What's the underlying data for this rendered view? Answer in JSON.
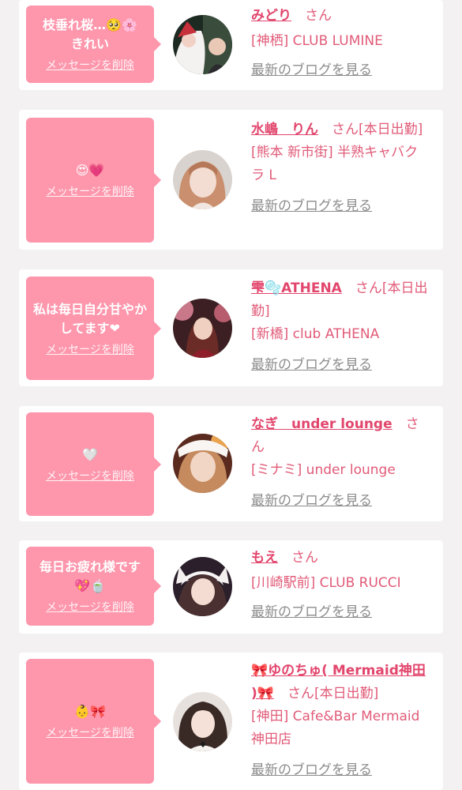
{
  "delete_label": "メッセージを削除",
  "blog_label": "最新のブログを見る",
  "san": "さん",
  "colors": {
    "bubble": "#fe96ac",
    "name": "#e2466d",
    "text": "#e15b78",
    "link": "#8c8c8c",
    "background": "#f3f1f2"
  },
  "cards": [
    {
      "message": "枝垂れ桜…🥺🌸\nきれい",
      "name": "みどり",
      "status": "",
      "shop": "[神栖] CLUB LUMINE"
    },
    {
      "message": "😍💗",
      "name": "水嶋　りん",
      "status": "[本日出勤]",
      "shop": "[熊本 新市街] 半熟キャバクラ L"
    },
    {
      "message": "私は毎日自分甘やかしてます❤",
      "name": "雫🫧ATHENA",
      "status": "[本日出勤]",
      "shop": "[新橋] club ATHENA"
    },
    {
      "message": "🤍",
      "name": "なぎ　under lounge",
      "status": "",
      "shop": "[ミナミ] under lounge"
    },
    {
      "message": "毎日お疲れ様です💖🍵",
      "name": "もえ",
      "status": "",
      "shop": "[川崎駅前] CLUB RUCCI"
    },
    {
      "message": "👶🎀",
      "name": "🎀ゆのちゅ( Mermaid神田 )🎀",
      "status": "[本日出勤]",
      "shop": "[神田] Cafe&Bar Mermaid神田店"
    }
  ]
}
